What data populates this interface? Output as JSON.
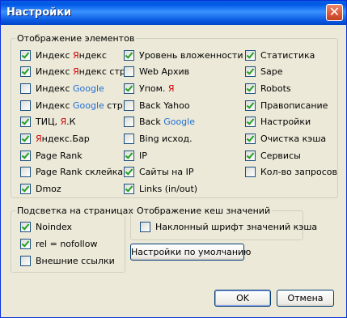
{
  "window": {
    "title": "Настройки",
    "close_glyph": "✕"
  },
  "groups": {
    "display": {
      "legend": "Отображение элементов",
      "columns": [
        [
          {
            "parts": [
              {
                "t": "Индекс "
              },
              {
                "t": "Я",
                "c": "r"
              },
              {
                "t": "ндекс"
              }
            ],
            "checked": true
          },
          {
            "parts": [
              {
                "t": "Индекс "
              },
              {
                "t": "Я",
                "c": "r"
              },
              {
                "t": "ндекс стр"
              }
            ],
            "checked": true
          },
          {
            "parts": [
              {
                "t": "Индекс "
              },
              {
                "t": "Google",
                "c": "b"
              }
            ],
            "checked": false
          },
          {
            "parts": [
              {
                "t": "Индекс "
              },
              {
                "t": "Google",
                "c": "b"
              },
              {
                "t": " стр"
              }
            ],
            "checked": false
          },
          {
            "parts": [
              {
                "t": "ТИЦ, "
              },
              {
                "t": "Я",
                "c": "r"
              },
              {
                "t": ".К"
              }
            ],
            "checked": true
          },
          {
            "parts": [
              {
                "t": "Я",
                "c": "r"
              },
              {
                "t": "ндекс.Бар"
              }
            ],
            "checked": true
          },
          {
            "parts": [
              {
                "t": "Page Rank"
              }
            ],
            "checked": true
          },
          {
            "parts": [
              {
                "t": "Page Rank склейка"
              }
            ],
            "checked": false
          },
          {
            "parts": [
              {
                "t": "Dmoz"
              }
            ],
            "checked": true
          }
        ],
        [
          {
            "parts": [
              {
                "t": "Уровень вложенности"
              }
            ],
            "checked": true
          },
          {
            "parts": [
              {
                "t": "Web Архив"
              }
            ],
            "checked": false
          },
          {
            "parts": [
              {
                "t": "Упом. "
              },
              {
                "t": "Я",
                "c": "r"
              }
            ],
            "checked": true
          },
          {
            "parts": [
              {
                "t": "Back Yahoo"
              }
            ],
            "checked": false
          },
          {
            "parts": [
              {
                "t": "Back "
              },
              {
                "t": "Google",
                "c": "b"
              }
            ],
            "checked": false
          },
          {
            "parts": [
              {
                "t": "Bing исход."
              }
            ],
            "checked": false
          },
          {
            "parts": [
              {
                "t": "IP"
              }
            ],
            "checked": true
          },
          {
            "parts": [
              {
                "t": "Сайты на IP"
              }
            ],
            "checked": true
          },
          {
            "parts": [
              {
                "t": "Links (in/out)"
              }
            ],
            "checked": true
          }
        ],
        [
          {
            "parts": [
              {
                "t": "Статистика"
              }
            ],
            "checked": true
          },
          {
            "parts": [
              {
                "t": "Sape"
              }
            ],
            "checked": true
          },
          {
            "parts": [
              {
                "t": "Robots"
              }
            ],
            "checked": true
          },
          {
            "parts": [
              {
                "t": "Правописание"
              }
            ],
            "checked": true
          },
          {
            "parts": [
              {
                "t": "Настройки"
              }
            ],
            "checked": true
          },
          {
            "parts": [
              {
                "t": "Очистка кэша"
              }
            ],
            "checked": true
          },
          {
            "parts": [
              {
                "t": "Сервисы"
              }
            ],
            "checked": true
          },
          {
            "parts": [
              {
                "t": "Кол-во запросов"
              }
            ],
            "checked": false
          }
        ]
      ]
    },
    "highlight": {
      "legend": "Подсветка на страницах",
      "items": [
        {
          "parts": [
            {
              "t": "Noindex"
            }
          ],
          "checked": true
        },
        {
          "parts": [
            {
              "t": "rel = nofollow"
            }
          ],
          "checked": true
        },
        {
          "parts": [
            {
              "t": "Внешние ссылки"
            }
          ],
          "checked": false
        }
      ]
    },
    "cache": {
      "legend": "Отображение кеш значений",
      "items": [
        {
          "parts": [
            {
              "t": "Наклонный шрифт значений кэша"
            }
          ],
          "checked": false
        }
      ]
    }
  },
  "buttons": {
    "defaults": "Настройки по умолчанию",
    "ok": "OK",
    "cancel": "Отмена"
  },
  "colors": {
    "yandex_red": "#d40000",
    "google_blue": "#1f6fd8",
    "check_green": "#21a121"
  }
}
